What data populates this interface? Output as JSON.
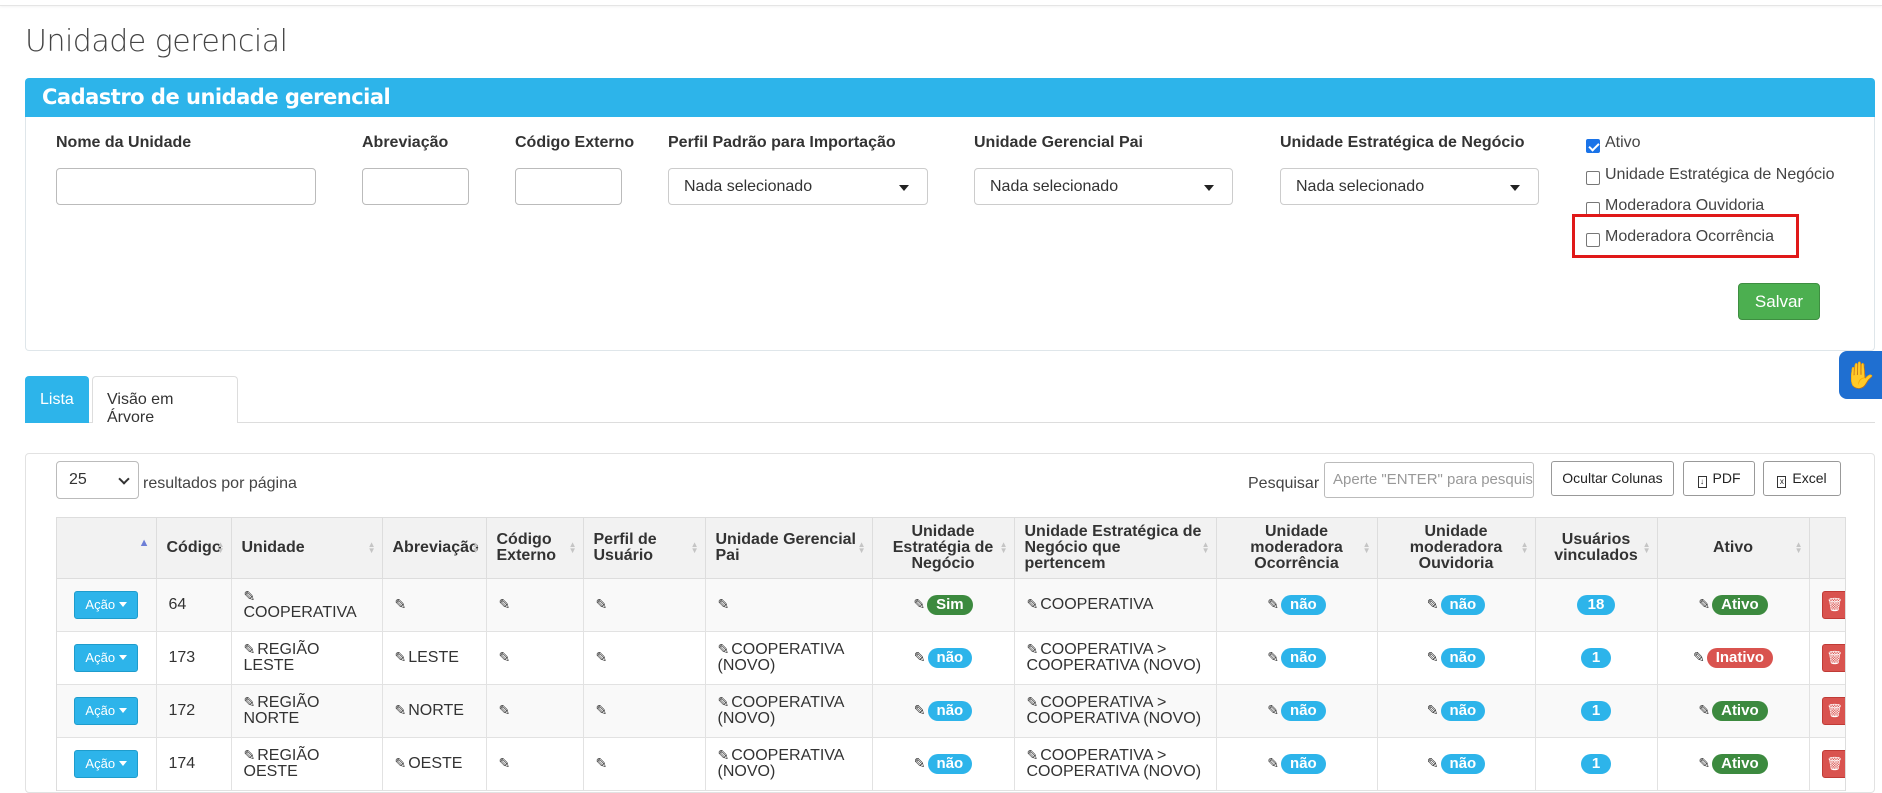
{
  "page": {
    "title": "Unidade gerencial"
  },
  "form": {
    "header": "Cadastro de unidade gerencial",
    "fields": {
      "nome": "Nome da Unidade",
      "abreviacao": "Abreviação",
      "codigo_externo": "Código Externo",
      "perfil": "Perfil Padrão para Importação",
      "pai": "Unidade Gerencial Pai",
      "estrategica": "Unidade Estratégica de Negócio"
    },
    "select_placeholder": "Nada selecionado",
    "checkboxes": [
      {
        "label": "Ativo",
        "checked": true
      },
      {
        "label": "Unidade Estratégica de Negócio",
        "checked": false
      },
      {
        "label": "Moderadora Ouvidoria",
        "checked": false
      },
      {
        "label": "Moderadora Ocorrência",
        "checked": false
      }
    ],
    "save": "Salvar",
    "highlight_color": "#e01818"
  },
  "tabs": [
    "Lista",
    "Visão em Árvore"
  ],
  "list": {
    "page_size": "25",
    "per_page_text": "resultados por página",
    "search_label": "Pesquisar",
    "search_placeholder": "Aperte \"ENTER\" para pesquisar",
    "buttons": {
      "cols": "Ocultar Colunas",
      "pdf": "PDF",
      "excel": "Excel"
    }
  },
  "table": {
    "headers": [
      "",
      "Código",
      "Unidade",
      "Abreviação",
      "Código Externo",
      "Perfil de Usuário",
      "Unidade Gerencial Pai",
      "Unidade Estratégia de Negócio",
      "Unidade Estratégica de Negócio que pertencem",
      "Unidade moderadora Ocorrência",
      "Unidade moderadora Ouvidoria",
      "Usuários vinculados",
      "Ativo",
      ""
    ],
    "action_label": "Ação",
    "rows": [
      {
        "codigo": "64",
        "unidade": "COOPERATIVA",
        "abrev": "",
        "pai": "",
        "estrategia": "Sim",
        "pertence": "COOPERATIVA",
        "ocorrencia": "não",
        "ouvidoria": "não",
        "usuarios": "18",
        "ativo": "Ativo"
      },
      {
        "codigo": "173",
        "unidade": "REGIÃO LESTE",
        "abrev": "LESTE",
        "pai": "COOPERATIVA (NOVO)",
        "estrategia": "não",
        "pertence": "COOPERATIVA > COOPERATIVA (NOVO)",
        "ocorrencia": "não",
        "ouvidoria": "não",
        "usuarios": "1",
        "ativo": "Inativo"
      },
      {
        "codigo": "172",
        "unidade": "REGIÃO NORTE",
        "abrev": "NORTE",
        "pai": "COOPERATIVA (NOVO)",
        "estrategia": "não",
        "pertence": "COOPERATIVA > COOPERATIVA (NOVO)",
        "ocorrencia": "não",
        "ouvidoria": "não",
        "usuarios": "1",
        "ativo": "Ativo"
      },
      {
        "codigo": "174",
        "unidade": "REGIÃO OESTE",
        "abrev": "OESTE",
        "pai": "COOPERATIVA (NOVO)",
        "estrategia": "não",
        "pertence": "COOPERATIVA > COOPERATIVA (NOVO)",
        "ocorrencia": "não",
        "ouvidoria": "não",
        "usuarios": "1",
        "ativo": "Ativo"
      }
    ]
  },
  "colors": {
    "primary": "#2db4ea",
    "success": "#3c8a3f",
    "danger": "#d9534f",
    "save": "#4caf50"
  }
}
